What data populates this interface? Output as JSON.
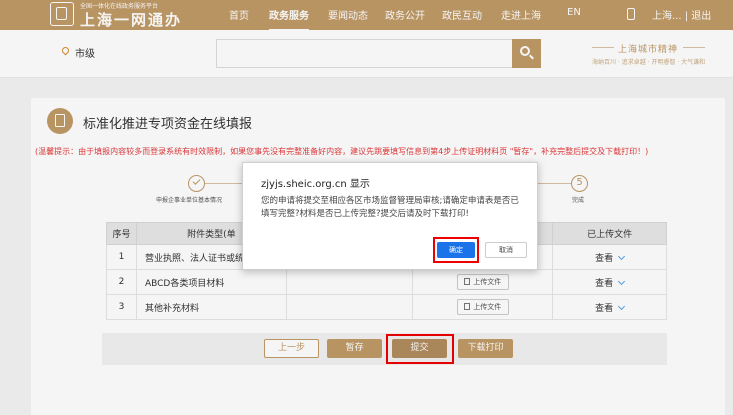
{
  "header": {
    "logo_subtitle": "全国一体化在线政务服务平台",
    "logo_title": "上海一网通办",
    "nav": [
      "首页",
      "政务服务",
      "要闻动态",
      "政务公开",
      "政民互动",
      "走进上海",
      "EN"
    ],
    "active_nav": "政务服务",
    "user_links": "上海... | 退出"
  },
  "search": {
    "location": "市级",
    "placeholder": "",
    "brand": "上海城市精神",
    "brand_sub": "海纳百川 · 追求卓越 · 开明睿智 · 大气谦和"
  },
  "page": {
    "title": "标准化推进专项资金在线填报",
    "warning": "(温馨提示：由于填报内容较多而登录系统有时效限制，如果您事先没有完整准备好内容，建议先跳要填写信息到第4步上传证明材料页 \"暂存\"，补充完整后提交及下载打印！)"
  },
  "steps": [
    {
      "label": "申报企事业单位基本情况",
      "state": "done"
    },
    {
      "label": "完成",
      "number": "5"
    }
  ],
  "table": {
    "headers": [
      "序号",
      "附件类型(单",
      "",
      "",
      "已上传文件"
    ],
    "rows": [
      {
        "no": "1",
        "type": "营业执照、法人证书或统一",
        "upload": "",
        "view": "查看"
      },
      {
        "no": "2",
        "type": "ABCD各类项目材料",
        "upload": "上传文件",
        "view": "查看"
      },
      {
        "no": "3",
        "type": "其他补充材料",
        "upload": "上传文件",
        "view": "查看"
      }
    ]
  },
  "buttons": {
    "prev": "上一步",
    "save": "暂存",
    "submit": "提交",
    "print": "下载打印"
  },
  "dialog": {
    "title": "zjyjs.sheic.org.cn 显示",
    "message": "您的申请将提交至相应各区市场监督管理局审核;请确定申请表是否已填写完整?材料是否已上传完整?提交后请及时下载打印!",
    "ok": "确定",
    "cancel": "取消"
  },
  "colors": {
    "brand": "#c19b68",
    "highlight": "#ee0000",
    "ok_button": "#1a73e8",
    "warning": "#e4393c"
  }
}
